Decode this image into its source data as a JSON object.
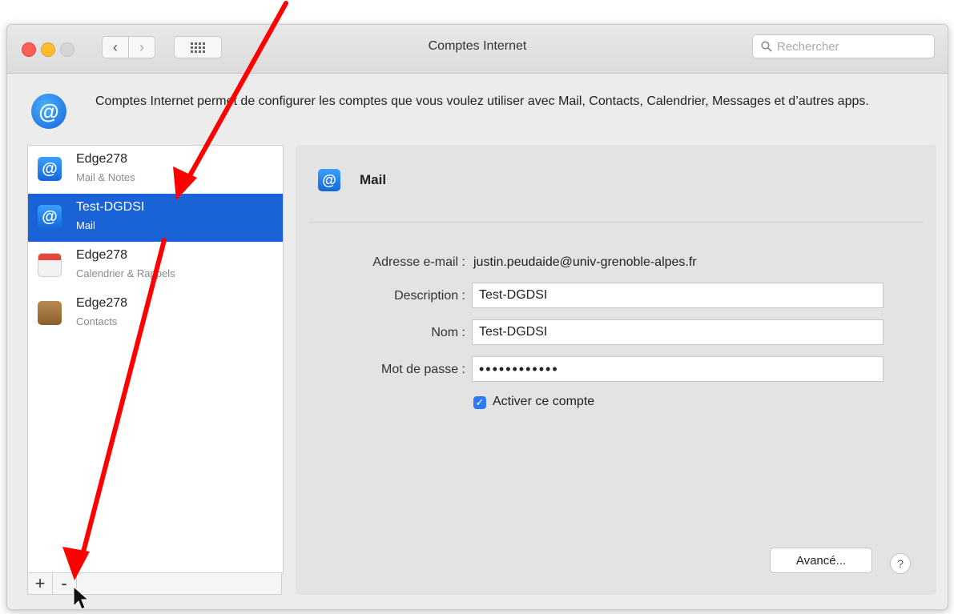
{
  "window": {
    "title": "Comptes Internet",
    "search_placeholder": "Rechercher",
    "nav_back": "‹",
    "nav_forward": "›"
  },
  "banner": {
    "icon": "@",
    "text": "Comptes Internet permet de configurer les comptes que vous voulez utiliser avec Mail, Contacts, Calendrier, Messages et d’autres apps."
  },
  "accounts": [
    {
      "name": "Edge278",
      "subtitle": "Mail & Notes",
      "icon": "mail-icon",
      "selected": false
    },
    {
      "name": "Test-DGDSI",
      "subtitle": "Mail",
      "icon": "mail-icon",
      "selected": true
    },
    {
      "name": "Edge278",
      "subtitle": "Calendrier & Rappels",
      "icon": "calendar-icon",
      "selected": false
    },
    {
      "name": "Edge278",
      "subtitle": "Contacts",
      "icon": "contacts-icon",
      "selected": false
    }
  ],
  "sidebar_controls": {
    "add": "+",
    "remove": "-"
  },
  "detail": {
    "heading": "Mail",
    "email_label": "Adresse e-mail :",
    "email_value": "justin.peudaide@univ-grenoble-alpes.fr",
    "description_label": "Description :",
    "description_value": "Test-DGDSI",
    "name_label": "Nom :",
    "name_value": "Test-DGDSI",
    "password_label": "Mot de passe :",
    "password_value": "••••••••••••",
    "enable_label": "Activer ce compte",
    "enable_checked": true,
    "advanced_button": "Avancé...",
    "help_button": "?"
  },
  "colors": {
    "selection": "#1a63d6",
    "annotation_arrow": "#ff0000"
  }
}
